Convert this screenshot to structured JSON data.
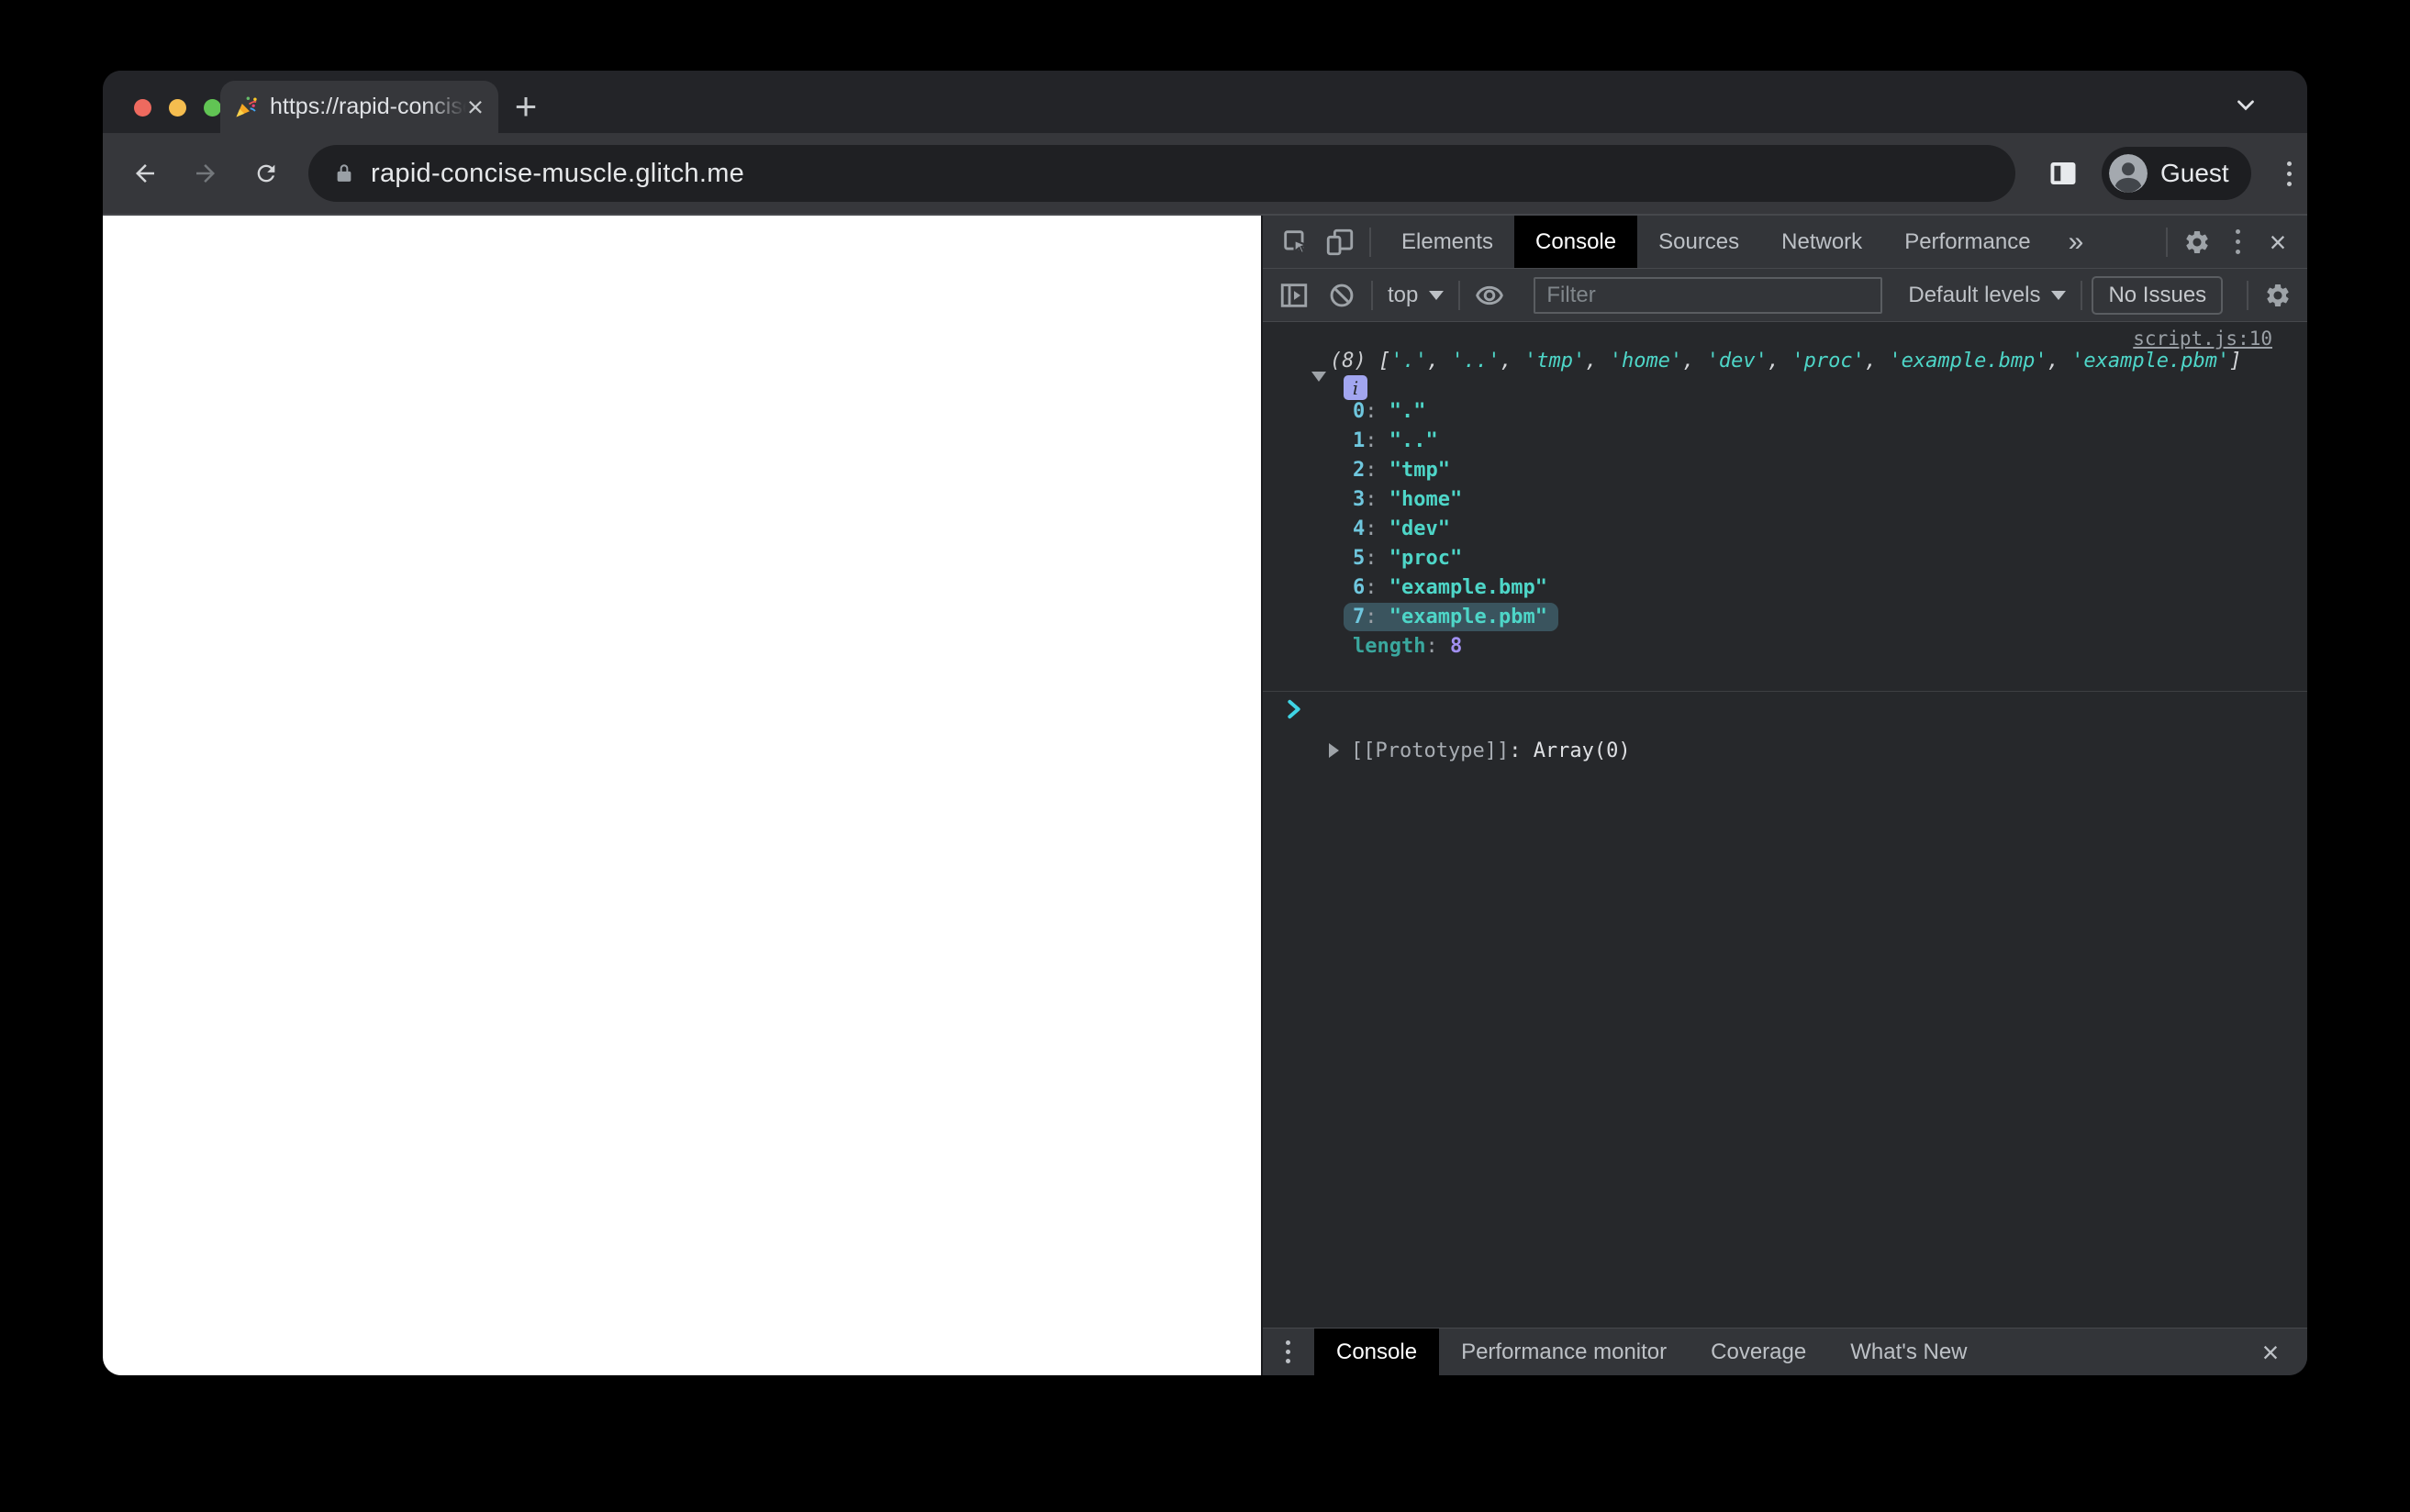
{
  "browser": {
    "tab_title": "https://rapid-concise-muscle.g",
    "url": "rapid-concise-muscle.glitch.me",
    "profile_label": "Guest",
    "icons": {
      "favicon": "party-popper",
      "new_tab": "+",
      "tab_close": "×",
      "tab_search": "chevron-down",
      "lock": "padlock",
      "menu": "three-dots-vertical"
    }
  },
  "devtools": {
    "tabs": [
      "Elements",
      "Console",
      "Sources",
      "Network",
      "Performance"
    ],
    "selected_tab": "Console",
    "more_tabs_glyph": "»",
    "close_glyph": "×",
    "toolbar": {
      "context_label": "top",
      "filter_placeholder": "Filter",
      "levels_label": "Default levels",
      "issues_label": "No Issues"
    },
    "console": {
      "source_link": "script.js:10",
      "count_badge": "(8)",
      "items": [
        ".",
        "..",
        "tmp",
        "home",
        "dev",
        "proc",
        "example.bmp",
        "example.pbm"
      ],
      "highlighted_index": 7,
      "length_label": "length",
      "length_value": "8",
      "prototype_label": "[[Prototype]]",
      "prototype_value": "Array(0)"
    },
    "drawer": {
      "tabs": [
        "Console",
        "Performance monitor",
        "Coverage",
        "What's New"
      ],
      "selected": "Console"
    }
  },
  "colors": {
    "chrome_strip": "#232428",
    "chrome_toolbar": "#36373B",
    "omnibox": "#1F2023",
    "devtools_bg": "#26282B",
    "devtools_toolbar": "#333539",
    "selected_tab_bg": "#000000",
    "string_teal": "#4ED6C8",
    "index_blue": "#6FC7DE",
    "number_purple": "#A18FF0",
    "info_badge": "#A2A6F0",
    "row_highlight": "#3A545E",
    "link_gray": "#9AA0A6",
    "traffic_red": "#EE6A5F",
    "traffic_yellow": "#F5BD4F",
    "traffic_green": "#61C454",
    "page_bg": "#FFFFFF"
  }
}
